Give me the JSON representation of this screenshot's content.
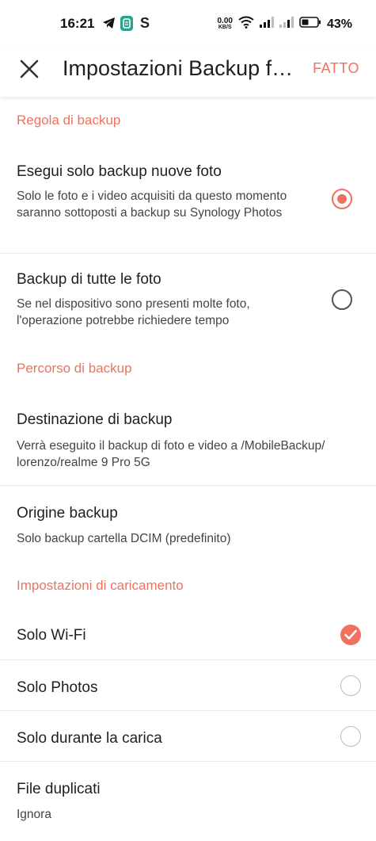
{
  "status_bar": {
    "time": "16:21",
    "speed_value": "0.00",
    "speed_unit": "KB/S",
    "battery": "43%"
  },
  "app_bar": {
    "title": "Impostazioni Backup foto",
    "done_label": "FATTO",
    "accent_color": "#f2705e"
  },
  "sections": {
    "backup_rule": {
      "header": "Regola di backup",
      "options": [
        {
          "title": "Esegui solo backup nuove foto",
          "description": "Solo le foto e i video acquisiti da questo momento saranno sottoposti a backup su Synology Photos",
          "selected": true
        },
        {
          "title": "Backup di tutte le foto",
          "description": "Se nel dispositivo sono presenti molte foto, l'operazione potrebbe richiedere tempo",
          "selected": false
        }
      ]
    },
    "backup_path": {
      "header": "Percorso di backup",
      "destination_title": "Destinazione di backup",
      "destination_desc": "Verrà eseguito il backup di foto e video a /MobileBackup/ lorenzo/realme 9 Pro 5G",
      "source_title": "Origine backup",
      "source_desc": "Solo backup cartella DCIM (predefinito)"
    },
    "upload_settings": {
      "header": "Impostazioni di caricamento",
      "wifi_only": {
        "label": "Solo Wi-Fi",
        "checked": true
      },
      "photos_only": {
        "label": "Solo Photos",
        "checked": false
      },
      "charging_only": {
        "label": "Solo durante la carica",
        "checked": false
      },
      "duplicates_title": "File duplicati",
      "duplicates_value": "Ignora"
    }
  }
}
